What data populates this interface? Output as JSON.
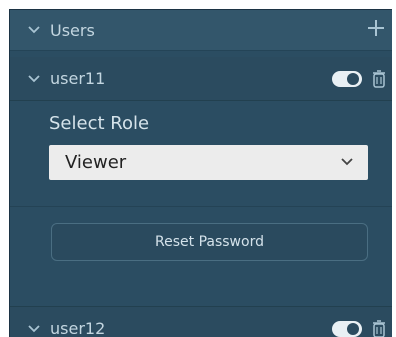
{
  "users_section": {
    "title": "Users",
    "add_icon": "plus-icon",
    "users": [
      {
        "name": "user11",
        "expanded": true,
        "enabled": true,
        "role_label": "Select Role",
        "role_value": "Viewer",
        "reset_label": "Reset Password"
      },
      {
        "name": "user12",
        "expanded": false,
        "enabled": true
      }
    ]
  },
  "colors": {
    "panel": "#2b4d62",
    "toggle_on": "#e9f0f4",
    "text": "#c3d6e0"
  }
}
